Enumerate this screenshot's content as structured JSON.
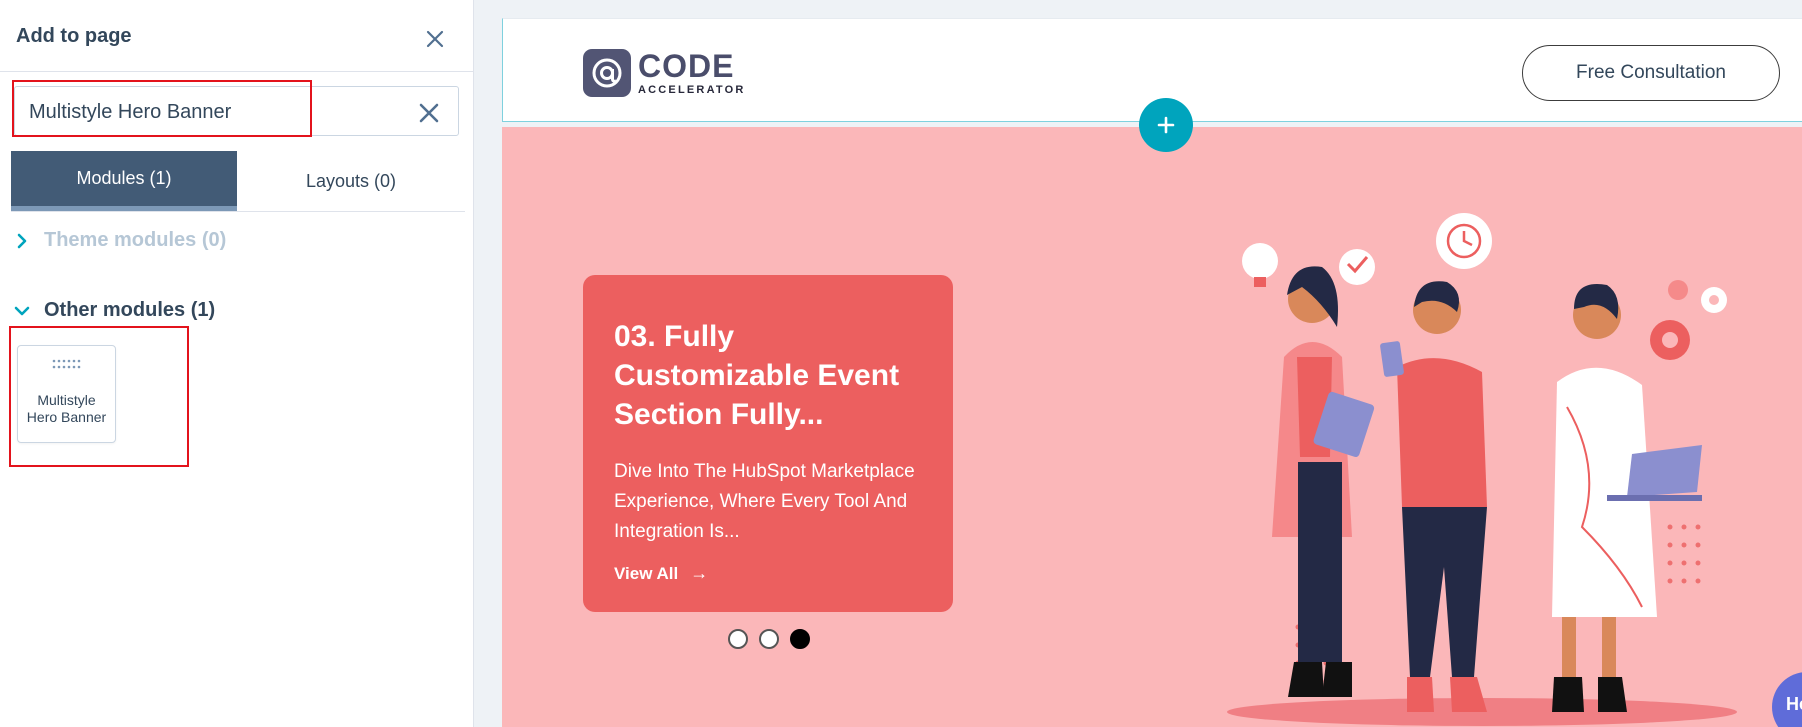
{
  "panel": {
    "title": "Add to page",
    "search": {
      "value": "Multistyle Hero Banner",
      "placeholder": "Search"
    },
    "tabs": [
      {
        "label": "Modules (1)",
        "active": true
      },
      {
        "label": "Layouts (0)",
        "active": false
      }
    ],
    "sections": {
      "theme": {
        "label": "Theme modules (0)",
        "expanded": false
      },
      "other": {
        "label": "Other modules (1)",
        "expanded": true
      }
    },
    "module": {
      "label": "Multistyle Hero Banner"
    }
  },
  "site": {
    "logo": {
      "word": "CODE",
      "sub": "ACCELERATOR"
    },
    "cta_label": "Free Consultation"
  },
  "hero": {
    "card_title": "03. Fully Customizable Event Section Fully...",
    "card_desc": "Dive Into The HubSpot Marketplace Experience, Where Every Tool And Integration Is...",
    "link_label": "View All",
    "slides": {
      "count": 3,
      "active": 3
    }
  },
  "help_label": "He",
  "colors": {
    "panel_tab_active": "#425b76",
    "accent_teal": "#00a4bd",
    "hero_bg": "#fbb7b9",
    "card_bg": "#ec5f5f",
    "highlight_red": "#e3131c"
  }
}
